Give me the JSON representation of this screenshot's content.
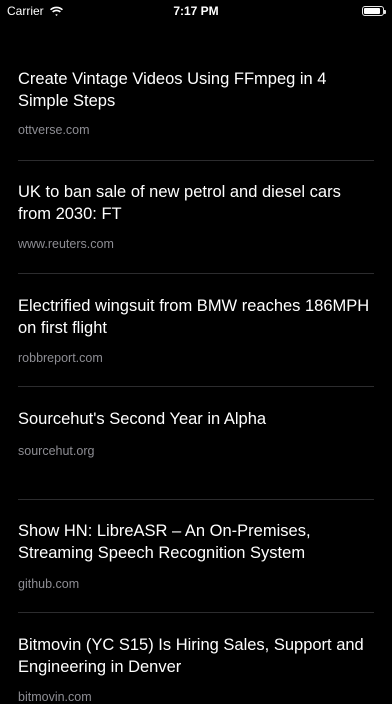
{
  "status_bar": {
    "carrier": "Carrier",
    "wifi_icon": "wifi-icon",
    "time": "7:17 PM",
    "battery_icon": "battery-icon",
    "battery_level": 0.9
  },
  "colors": {
    "background": "#000000",
    "title": "#ffffff",
    "domain": "#8d8d93",
    "divider": "#2c2c2e"
  },
  "items": [
    {
      "title": "Create Vintage Videos Using FFmpeg in 4 Simple Steps",
      "domain": "ottverse.com"
    },
    {
      "title": "UK to ban sale of new petrol and diesel cars from 2030: FT",
      "domain": "www.reuters.com"
    },
    {
      "title": "Electrified wingsuit from BMW reaches 186MPH on first flight",
      "domain": "robbreport.com"
    },
    {
      "title": "Sourcehut's Second Year in Alpha",
      "domain": "sourcehut.org"
    },
    {
      "title": "Show HN: LibreASR – An On-Premises, Streaming Speech Recognition System",
      "domain": "github.com"
    },
    {
      "title": "Bitmovin (YC S15) Is Hiring Sales, Support and Engineering in Denver",
      "domain": "bitmovin.com"
    }
  ]
}
